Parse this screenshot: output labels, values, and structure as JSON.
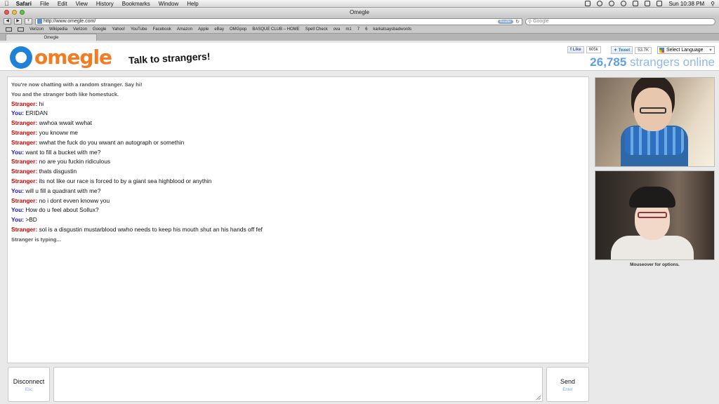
{
  "menubar": {
    "apple": "",
    "items": [
      "Safari",
      "File",
      "Edit",
      "View",
      "History",
      "Bookmarks",
      "Window",
      "Help"
    ],
    "clock": "Sun 10:38 PM"
  },
  "window": {
    "title": "Omegle",
    "url": "http://www.omegle.com/",
    "reader_label": "Reader",
    "search_placeholder": "Google",
    "tab_title": "Omegle"
  },
  "bookmarks": [
    "Verizon",
    "Wikipedia",
    "Verizon",
    "Google",
    "Yahoo!",
    "YouTube",
    "Facebook",
    "Amazon",
    "Apple",
    "eBay",
    "OMGpop",
    "BASQUE CLUB – HOME",
    "Spell Check",
    "ova",
    "m1",
    "7",
    "6",
    "karkatsaysbadwords"
  ],
  "header": {
    "logo_text": "omegle",
    "tagline": "Talk to strangers!",
    "facebook": {
      "label": "Like",
      "count": "605k"
    },
    "twitter": {
      "label": "Tweet",
      "count": "53.7K"
    },
    "language": "Select Language",
    "online_count": "26,785",
    "online_label": "strangers online"
  },
  "chat": {
    "messages": [
      {
        "type": "sys",
        "text": "You're now chatting with a random stranger. Say hi!"
      },
      {
        "type": "sys",
        "text": "You and the stranger both like homestuck."
      },
      {
        "type": "stranger",
        "label": "Stranger:",
        "text": "hi"
      },
      {
        "type": "you",
        "label": "You:",
        "text": "ERIDAN"
      },
      {
        "type": "stranger",
        "label": "Stranger:",
        "text": "wwhoa wwait wwhat"
      },
      {
        "type": "stranger",
        "label": "Stranger:",
        "text": "you knoww me"
      },
      {
        "type": "stranger",
        "label": "Stranger:",
        "text": "wwhat the fuck do you wwant an autograph or somethin"
      },
      {
        "type": "you",
        "label": "You:",
        "text": "want to fill a bucket with me?"
      },
      {
        "type": "stranger",
        "label": "Stranger:",
        "text": "no are you fuckin ridiculous"
      },
      {
        "type": "stranger",
        "label": "Stranger:",
        "text": "thats disgustin"
      },
      {
        "type": "stranger",
        "label": "Stranger:",
        "text": "its not like our race is forced to by a giant sea highblood or anythin"
      },
      {
        "type": "you",
        "label": "You:",
        "text": "will u fill a quadrant with me?"
      },
      {
        "type": "stranger",
        "label": "Stranger:",
        "text": "no i dont evven knoww you"
      },
      {
        "type": "you",
        "label": "You:",
        "text": "How do u feel about Sollux?"
      },
      {
        "type": "you",
        "label": "You:",
        "text": ">BD"
      },
      {
        "type": "stranger",
        "label": "Stranger:",
        "text": "sol is a disgustin mustarblood wwho needs to keep his mouth shut an his hands off fef"
      },
      {
        "type": "sys",
        "text": "Stranger is typing..."
      }
    ]
  },
  "video": {
    "hint": "Mouseover for options."
  },
  "controls": {
    "disconnect": {
      "label": "Disconnect",
      "hint": "Esc"
    },
    "send": {
      "label": "Send",
      "hint": "Enter"
    },
    "message_value": ""
  }
}
